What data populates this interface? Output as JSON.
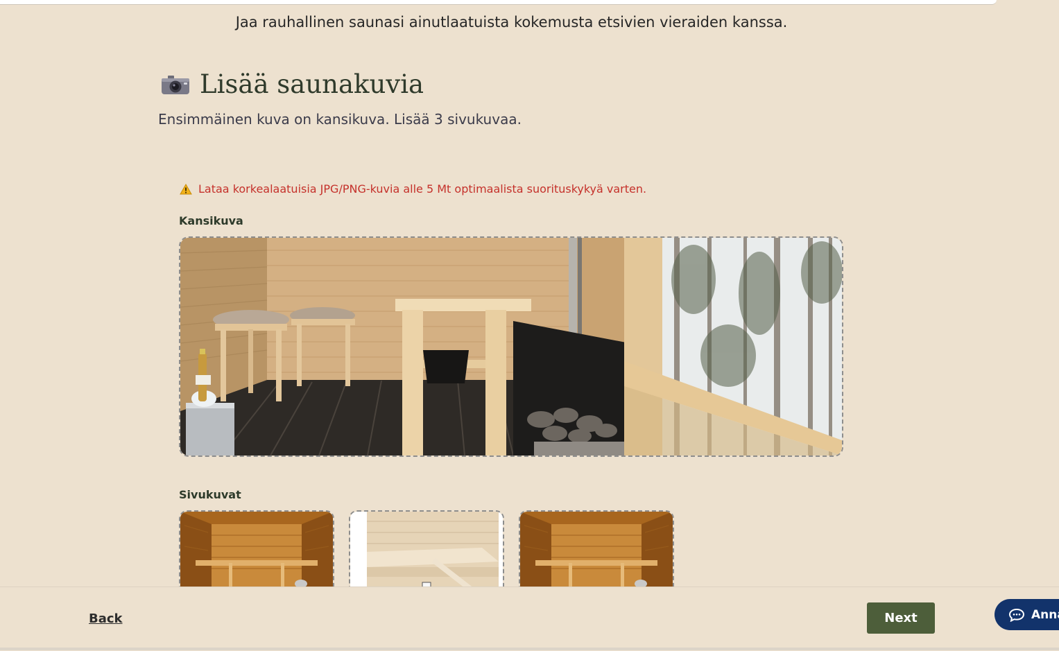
{
  "intro_text": "Jaa rauhallinen saunasi ainutlaatuista kokemusta etsivien vieraiden kanssa.",
  "section": {
    "icon": "camera-icon",
    "title": "Lisää saunakuvia",
    "subtitle": "Ensimmäinen kuva on kansikuva. Lisää 3 sivukuvaa."
  },
  "warning": {
    "icon": "warning-icon",
    "text": "Lataa korkealaatuisia JPG/PNG-kuvia alle 5 Mt optimaalista suorituskykyä varten."
  },
  "cover": {
    "label": "Kansikuva",
    "image": "sauna-cover-photo"
  },
  "side_images": {
    "label": "Sivukuvat",
    "items": [
      "sauna-interior-photo",
      "sauna-bench-photo",
      "sauna-interior-photo"
    ]
  },
  "footer": {
    "back_label": "Back",
    "next_label": "Next",
    "chat_label": "Anna",
    "chat_icon": "chat-bubble-icon"
  },
  "colors": {
    "background": "#ede1cf",
    "primary_button": "#4d5e3a",
    "warning_text": "#c5312b",
    "chat_button": "#12336b"
  }
}
